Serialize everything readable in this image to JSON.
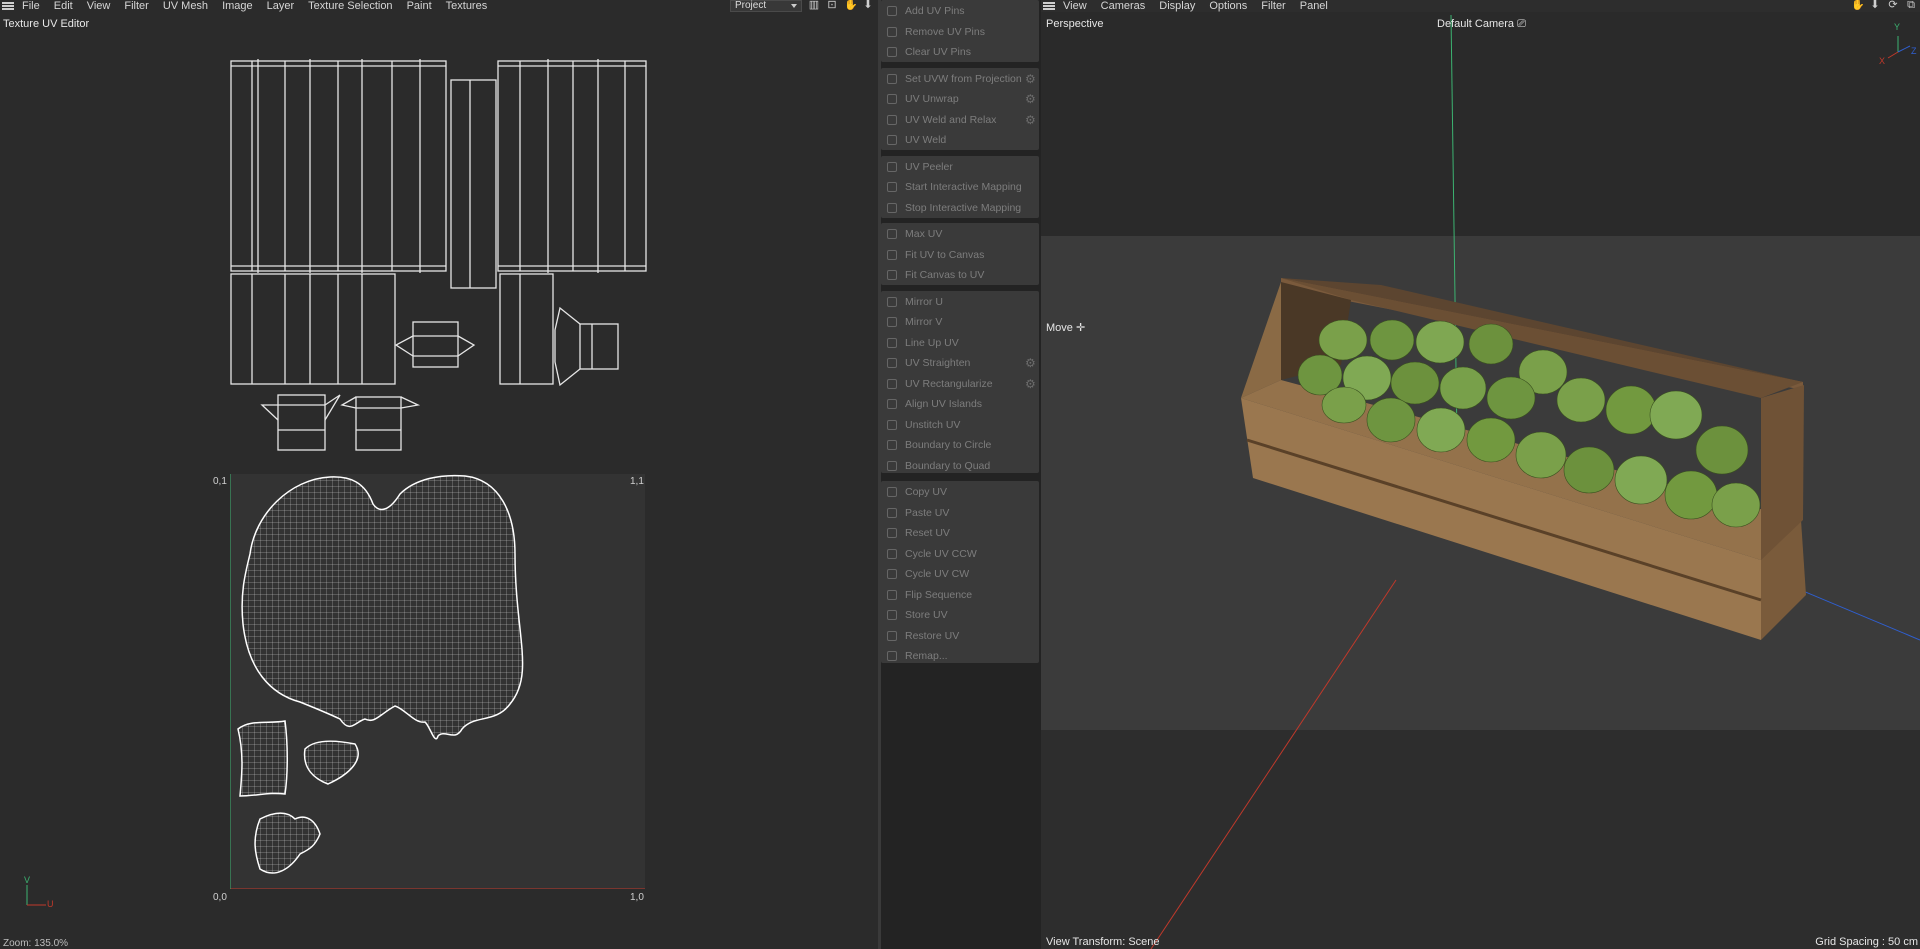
{
  "left_panel": {
    "menu": [
      "File",
      "Edit",
      "View",
      "Filter",
      "UV Mesh",
      "Image",
      "Layer",
      "Texture Selection",
      "Paint",
      "Textures"
    ],
    "project_select": "Project",
    "title": "Texture UV Editor",
    "zoom": "Zoom: 135.0%",
    "coords": {
      "tl": "0,1",
      "tr": "1,1",
      "bl": "0,0",
      "br": "1,0"
    },
    "axis": {
      "v": "V",
      "u": "U"
    }
  },
  "commands": {
    "groups": [
      [
        {
          "label": "Add UV Pins",
          "gear": false,
          "icon": "pin-icon"
        },
        {
          "label": "Remove UV Pins",
          "gear": false,
          "icon": "pin-remove-icon"
        },
        {
          "label": "Clear UV Pins",
          "gear": false,
          "icon": "close-icon"
        }
      ],
      [
        {
          "label": "Set UVW from Projection",
          "gear": true,
          "icon": "projection-icon"
        },
        {
          "label": "UV Unwrap",
          "gear": true,
          "icon": "unwrap-icon"
        },
        {
          "label": "UV Weld and Relax",
          "gear": true,
          "icon": "weld-relax-icon"
        },
        {
          "label": "UV Weld",
          "gear": false,
          "icon": "weld-icon"
        }
      ],
      [
        {
          "label": "UV Peeler",
          "gear": false,
          "icon": "peeler-icon"
        },
        {
          "label": "Start Interactive Mapping",
          "gear": false,
          "icon": "play-icon"
        },
        {
          "label": "Stop Interactive Mapping",
          "gear": false,
          "icon": "stop-icon"
        }
      ],
      [
        {
          "label": "Max UV",
          "gear": false,
          "icon": "max-icon"
        },
        {
          "label": "Fit UV to Canvas",
          "gear": false,
          "icon": "fit-icon"
        },
        {
          "label": "Fit Canvas to UV",
          "gear": false,
          "icon": "fit-canvas-icon"
        }
      ],
      [
        {
          "label": "Mirror U",
          "gear": false,
          "icon": "mirror-u-icon"
        },
        {
          "label": "Mirror V",
          "gear": false,
          "icon": "mirror-v-icon"
        },
        {
          "label": "Line Up UV",
          "gear": false,
          "icon": "line-up-icon"
        },
        {
          "label": "UV Straighten",
          "gear": true,
          "icon": "straighten-icon"
        },
        {
          "label": "UV Rectangularize",
          "gear": true,
          "icon": "rectangularize-icon"
        },
        {
          "label": "Align UV Islands",
          "gear": false,
          "icon": "align-icon"
        },
        {
          "label": "Unstitch UV",
          "gear": false,
          "icon": "unstitch-icon"
        },
        {
          "label": "Boundary to Circle",
          "gear": false,
          "icon": "circle-icon"
        },
        {
          "label": "Boundary to Quad",
          "gear": false,
          "icon": "quad-icon"
        }
      ],
      [
        {
          "label": "Copy UV",
          "gear": false,
          "icon": "copy-icon"
        },
        {
          "label": "Paste UV",
          "gear": false,
          "icon": "paste-icon"
        },
        {
          "label": "Reset UV",
          "gear": false,
          "icon": "reset-icon"
        },
        {
          "label": "Cycle UV CCW",
          "gear": false,
          "icon": "cycle-ccw-icon"
        },
        {
          "label": "Cycle UV CW",
          "gear": false,
          "icon": "cycle-cw-icon"
        },
        {
          "label": "Flip Sequence",
          "gear": false,
          "icon": "flip-icon"
        },
        {
          "label": "Store UV",
          "gear": false,
          "icon": "store-icon"
        },
        {
          "label": "Restore UV",
          "gear": false,
          "icon": "restore-icon"
        },
        {
          "label": "Remap...",
          "gear": false,
          "icon": "remap-icon"
        }
      ]
    ]
  },
  "viewport": {
    "menu": [
      "View",
      "Cameras",
      "Display",
      "Options",
      "Filter",
      "Panel"
    ],
    "projection": "Perspective",
    "camera": "Default Camera",
    "tool": "Move",
    "view_transform": "View Transform: Scene",
    "grid_spacing": "Grid Spacing : 50 cm",
    "axis": {
      "x": "X",
      "y": "Y",
      "z": "Z"
    }
  },
  "colors": {
    "wireframe": "#e6e6e6",
    "axis_x": "#c0392b",
    "axis_y": "#3cb371",
    "axis_z": "#2f5fd0",
    "wood": "#8a6a45",
    "fruit": "#6e8f3a"
  }
}
